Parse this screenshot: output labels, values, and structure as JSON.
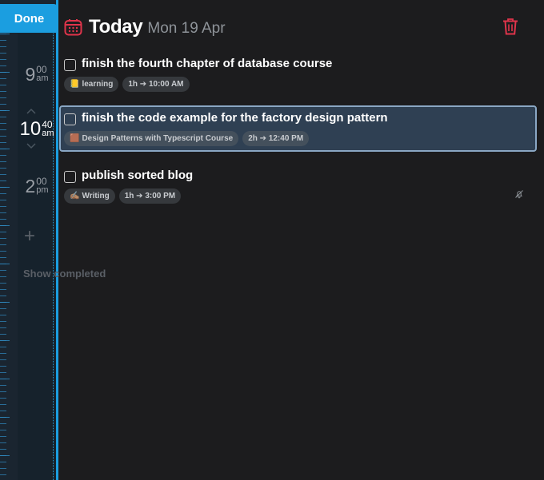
{
  "rail": {
    "done_label": "Done",
    "times": [
      {
        "hour": "9",
        "minutes": "00",
        "ampm": "am"
      },
      {
        "hour": "10",
        "minutes": "40",
        "ampm": "am"
      },
      {
        "hour": "2",
        "minutes": "00",
        "ampm": "pm"
      }
    ],
    "add_label": "+",
    "show_completed_label": "Show completed"
  },
  "header": {
    "title": "Today",
    "date": "Mon 19 Apr",
    "calendar_icon": "calendar-icon",
    "trash_icon": "trash-icon"
  },
  "tasks": [
    {
      "title": "finish the fourth chapter of database course",
      "project": {
        "emoji": "📒",
        "label": "learning"
      },
      "duration": "1h ➔ 10:00 AM",
      "selected": false
    },
    {
      "title": "finish the code example for the factory design pattern",
      "project": {
        "emoji": "🟫",
        "label": "Design Patterns with Typescript Course"
      },
      "duration": "2h ➔ 12:40 PM",
      "selected": true
    },
    {
      "title": "publish sorted blog",
      "project": {
        "emoji": "✍🏽",
        "label": "Writing"
      },
      "duration": "1h ➔ 3:00 PM",
      "selected": false,
      "icon": "bell-off-icon"
    }
  ],
  "colors": {
    "background": "#1c1c1e",
    "accent": "#1b9ee0",
    "selected_bg": "#2f4053",
    "selected_border": "#8aa7c4",
    "danger": "#e0344b"
  }
}
